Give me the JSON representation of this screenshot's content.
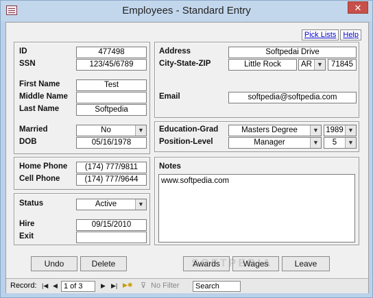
{
  "window": {
    "title": "Employees - Standard Entry",
    "close": "✕"
  },
  "links": {
    "pick_lists": "Pick Lists",
    "help": "Help"
  },
  "fields": {
    "id": {
      "label": "ID",
      "value": "477498"
    },
    "ssn": {
      "label": "SSN",
      "value": "123/45/6789"
    },
    "first_name": {
      "label": "First Name",
      "value": "Test"
    },
    "middle_name": {
      "label": "Middle Name",
      "value": ""
    },
    "last_name": {
      "label": "Last Name",
      "value": "Softpedia"
    },
    "married": {
      "label": "Married",
      "value": "No"
    },
    "dob": {
      "label": "DOB",
      "value": "05/16/1978"
    },
    "address": {
      "label": "Address",
      "value": "Softpedai Drive"
    },
    "city_state_zip": {
      "label": "City-State-ZIP",
      "city": "Little Rock",
      "state": "AR",
      "zip": "71845"
    },
    "email": {
      "label": "Email",
      "value": "softpedia@softpedia.com"
    },
    "education": {
      "label": "Education-Grad",
      "value": "Masters Degree",
      "year": "1989"
    },
    "position": {
      "label": "Position-Level",
      "value": "Manager",
      "level": "5"
    },
    "home_phone": {
      "label": "Home Phone",
      "value": "(174) 777/9811"
    },
    "cell_phone": {
      "label": "Cell Phone",
      "value": "(174) 777/9644"
    },
    "status": {
      "label": "Status",
      "value": "Active"
    },
    "hire": {
      "label": "Hire",
      "value": "09/15/2010"
    },
    "exit": {
      "label": "Exit",
      "value": ""
    },
    "notes": {
      "label": "Notes",
      "value": "www.softpedia.com"
    }
  },
  "buttons": {
    "undo": "Undo",
    "delete": "Delete",
    "awards": "Awards",
    "wages": "Wages",
    "leave": "Leave"
  },
  "statusbar": {
    "record_label": "Record:",
    "record_value": "1 of 3",
    "no_filter": "No Filter",
    "search": "Search"
  },
  "watermark": "SOFTPEDIA"
}
